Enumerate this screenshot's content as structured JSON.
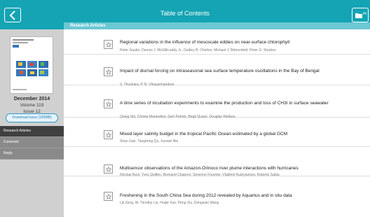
{
  "header": {
    "title": "Table of Contents",
    "back_icon": "chevron-left-icon",
    "folder_icon": "folder-icon",
    "folder_count": "(0)",
    "bar_color": "#14a4b4"
  },
  "sidebar": {
    "issue_date": "December 2014",
    "volume": "Volume 119",
    "issue": "Issue 12",
    "download_label": "Download Issue (182MB)",
    "nav": [
      {
        "label": "Research Articles",
        "active": true
      },
      {
        "label": "Comment",
        "active": false
      },
      {
        "label": "Reply",
        "active": false
      }
    ]
  },
  "main": {
    "section_label": "Research Articles",
    "articles": [
      {
        "title": "Regional variations in the influence of mesoscale eddies on near-surface chlorophyll",
        "authors": "Peter Gaube, Dennis J. McGillicuddy Jr., Dudley B. Chelton, Michael J. Behrenfeld, Peter G. Strutton"
      },
      {
        "title": "Impact of diurnal forcing on intraseasonal sea surface temperature oscillations in the Bay of Bengal",
        "authors": "V. Thushara, P. N. Vinayachandran"
      },
      {
        "title": "A time series of incubation experiments to examine the production and loss of CH3I in surface seawater",
        "authors": "Qiang Shi, Christa Marandino, Gert Petrick, Birgit Quack, Douglas Wallace"
      },
      {
        "title": "Mixed layer salinity budget in the tropical Pacific Ocean estimated by a global GCM",
        "authors": "Shan Gao, Tangdong Qu, Xunwei Nie"
      },
      {
        "title": "Multisensor observations of the Amazon-Orinoco river plume interactions with hurricanes",
        "authors": "Nicolas Reul, Yves Quilfen, Bertrand Chapron, Severine Fournier, Vladimir Kudryavtsev, Roberto Sabia"
      },
      {
        "title": "Freshening in the South China Sea during 2012 revealed by Aquarius and in situ data",
        "authors": "Lili Zeng, W. Timothy Liu, Huijie Xue, Peng Xiu, Dongxiao Wang"
      }
    ]
  }
}
